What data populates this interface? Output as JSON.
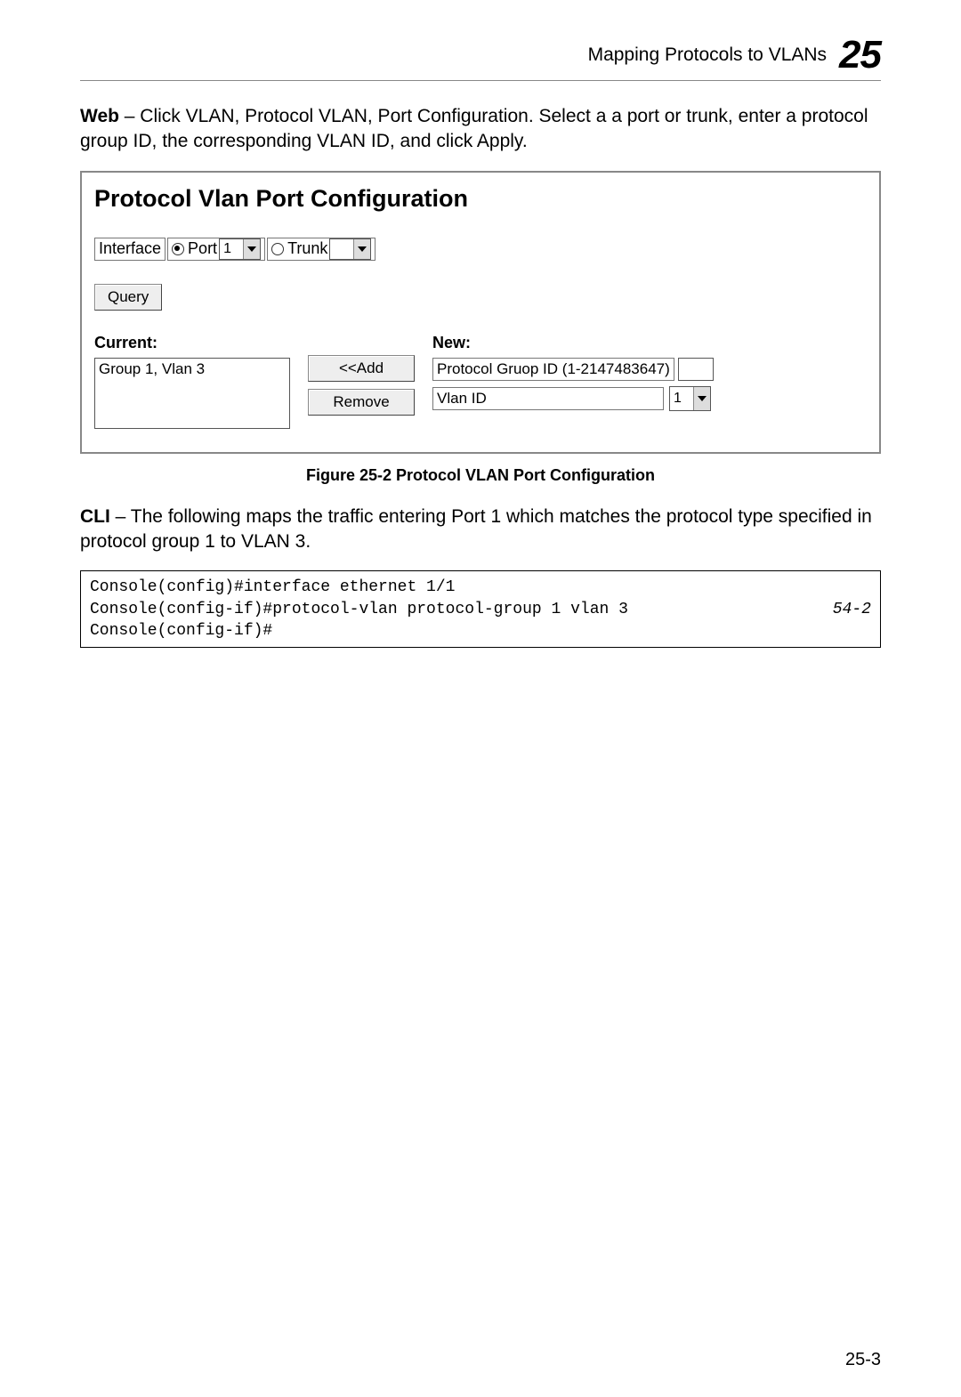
{
  "header": {
    "section_title": "Mapping Protocols to VLANs",
    "chapter_number": "25"
  },
  "para_web": {
    "label": "Web",
    "text": " – Click VLAN, Protocol VLAN, Port Configuration. Select a a port or trunk, enter a protocol group ID, the corresponding VLAN ID, and click Apply."
  },
  "gui": {
    "heading": "Protocol Vlan Port Configuration",
    "interface_label": "Interface",
    "port_label": "Port",
    "port_value": "1",
    "trunk_label": "Trunk",
    "trunk_value": "",
    "query_btn": "Query",
    "current_heading": "Current:",
    "current_list": "Group 1, Vlan 3",
    "add_btn": "<<Add",
    "remove_btn": "Remove",
    "new_heading": "New:",
    "proto_label": "Protocol Gruop ID (1-2147483647)",
    "proto_value": "",
    "vlan_label": "Vlan ID",
    "vlan_value": "1"
  },
  "figure_caption": "Figure 25-2  Protocol VLAN Port Configuration",
  "para_cli": {
    "label": "CLI",
    "text": " – The following maps the traffic entering Port 1 which matches the protocol type specified in protocol group 1 to VLAN 3."
  },
  "cli_block": {
    "line1": "Console(config)#interface ethernet 1/1",
    "line2": "Console(config-if)#protocol-vlan protocol-group 1 vlan 3",
    "ref": "54-2",
    "line3": "Console(config-if)#"
  },
  "page_number": "25-3"
}
